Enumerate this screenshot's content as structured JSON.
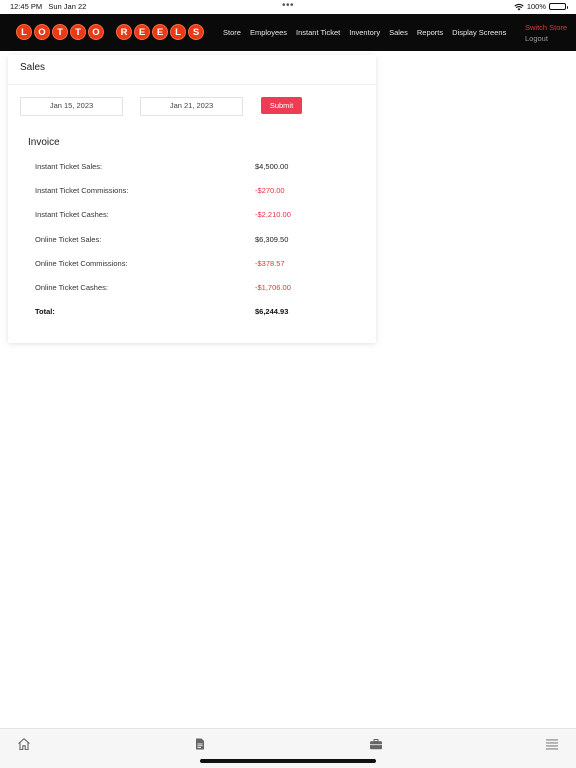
{
  "status_bar": {
    "time": "12:45 PM",
    "date": "Sun Jan 22",
    "battery": "100%"
  },
  "brand": {
    "logo_letters_1": [
      "L",
      "O",
      "T",
      "T",
      "O"
    ],
    "logo_letters_2": [
      "R",
      "E",
      "E",
      "L",
      "S"
    ]
  },
  "nav": {
    "items": [
      "Store",
      "Employees",
      "Instant Ticket",
      "Inventory",
      "Sales",
      "Reports",
      "Display Screens"
    ],
    "switch_store": "Switch Store",
    "logout": "Logout"
  },
  "sales": {
    "title": "Sales",
    "date_from": "Jan 15, 2023",
    "date_to": "Jan 21, 2023",
    "submit_label": "Submit",
    "invoice_title": "Invoice",
    "rows": [
      {
        "label": "Instant Ticket Sales:",
        "value": "$4,500.00",
        "negative": false
      },
      {
        "label": "Instant Ticket Commissions:",
        "value": "-$270.00",
        "negative": true
      },
      {
        "label": "Instant Ticket Cashes:",
        "value": "-$2,210.00",
        "negative": true
      },
      {
        "label": "Online Ticket Sales:",
        "value": "$6,309.50",
        "negative": false
      },
      {
        "label": "Online Ticket Commissions:",
        "value": "-$378.57",
        "negative": true
      },
      {
        "label": "Online Ticket Cashes:",
        "value": "-$1,706.00",
        "negative": true
      }
    ],
    "total": {
      "label": "Total:",
      "value": "$6,244.93"
    }
  },
  "tabbar": {
    "icons": [
      "home-icon",
      "document-icon",
      "briefcase-icon",
      "menu-icon"
    ]
  },
  "colors": {
    "accent": "#ee3c55",
    "negative": "#e5323c",
    "navbar_bg": "#0a0a0a",
    "logo_ball": "#e83a17"
  }
}
